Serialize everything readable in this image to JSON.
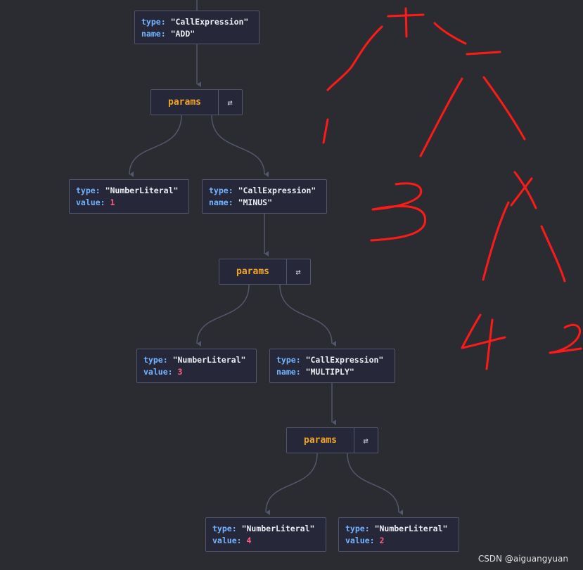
{
  "tree": {
    "root": {
      "type_key": "type:",
      "type_val": "\"CallExpression\"",
      "name_key": "name:",
      "name_val": "\"ADD\""
    },
    "params1": {
      "label": "params",
      "toggle": "⇄"
    },
    "left1": {
      "type_key": "type:",
      "type_val": "\"NumberLiteral\"",
      "value_key": "value:",
      "value_val": "1"
    },
    "right1": {
      "type_key": "type:",
      "type_val": "\"CallExpression\"",
      "name_key": "name:",
      "name_val": "\"MINUS\""
    },
    "params2": {
      "label": "params",
      "toggle": "⇄"
    },
    "left2": {
      "type_key": "type:",
      "type_val": "\"NumberLiteral\"",
      "value_key": "value:",
      "value_val": "3"
    },
    "right2": {
      "type_key": "type:",
      "type_val": "\"CallExpression\"",
      "name_key": "name:",
      "name_val": "\"MULTIPLY\""
    },
    "params3": {
      "label": "params",
      "toggle": "⇄"
    },
    "left3": {
      "type_key": "type:",
      "type_val": "\"NumberLiteral\"",
      "value_key": "value:",
      "value_val": "4"
    },
    "right3": {
      "type_key": "type:",
      "type_val": "\"NumberLiteral\"",
      "value_key": "value:",
      "value_val": "2"
    }
  },
  "annotation": {
    "color": "#ff1a1a",
    "glyphs": [
      "+",
      "-",
      "3",
      "×",
      "4",
      "2"
    ]
  },
  "watermark": "CSDN @aiguangyuan",
  "colors": {
    "background": "#2b2c31",
    "node_bg": "#26283a",
    "edge": "#53576b",
    "key": "#74b3ff",
    "number": "#ff5e87",
    "params": "#f3a623"
  }
}
